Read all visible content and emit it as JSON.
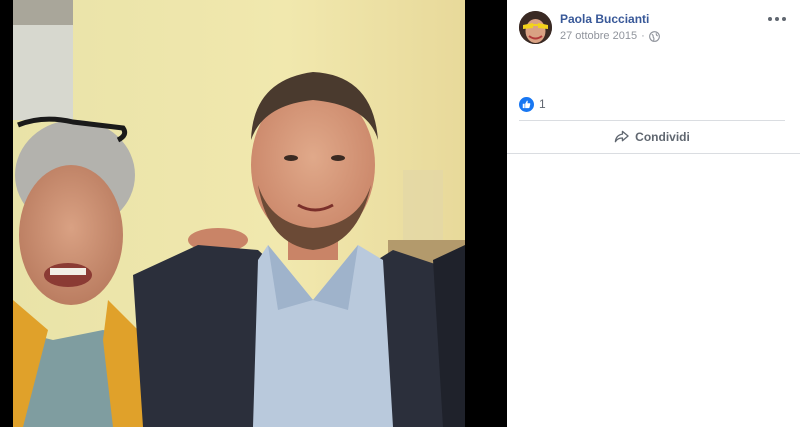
{
  "post": {
    "author": "Paola Buccianti",
    "date": "27 ottobre 2015",
    "separator": "·",
    "privacy_icon": "globe-icon",
    "options_icon": "more-options-icon"
  },
  "reactions": {
    "icon": "like-icon",
    "count": "1"
  },
  "actions": {
    "share_label": "Condividi",
    "share_icon": "share-arrow-icon"
  },
  "colors": {
    "author_link": "#385898",
    "secondary_text": "#90949c",
    "like_blue": "#1877f2",
    "divider": "#dadde1"
  }
}
